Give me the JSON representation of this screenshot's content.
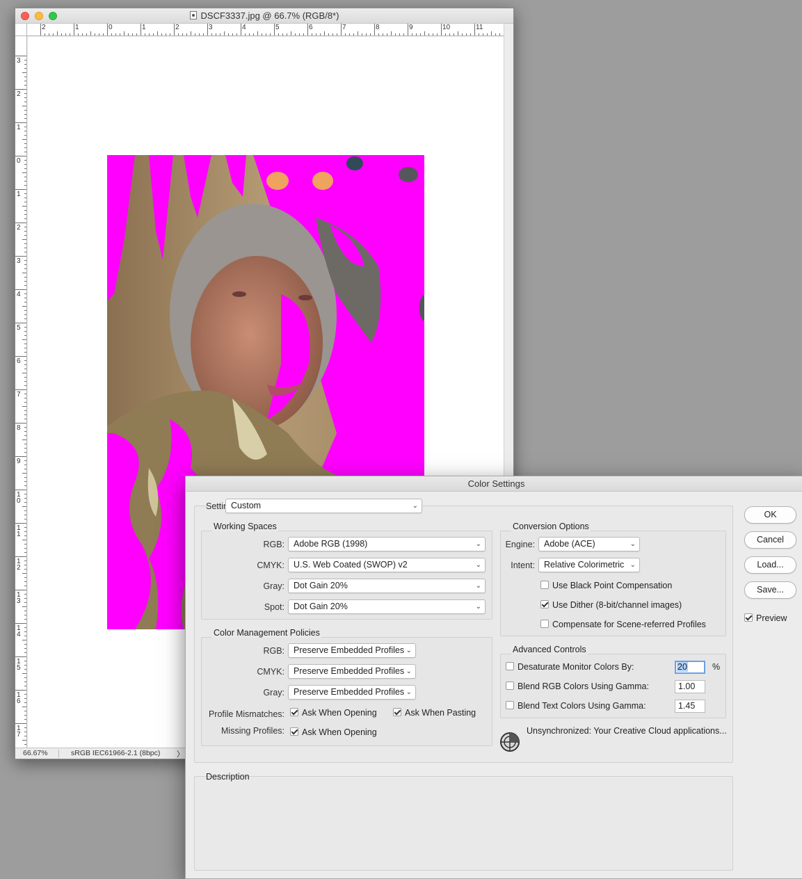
{
  "document": {
    "title": "DSCF3337.jpg @ 66.7% (RGB/8*)",
    "zoom": "66.67%",
    "color_profile": "sRGB IEC61966-2.1 (8bpc)",
    "status_arrow": "〉",
    "ruler_h_labels": [
      "2",
      "1",
      "0",
      "1",
      "2",
      "3",
      "4",
      "5",
      "6",
      "7",
      "8",
      "9",
      "10",
      "11"
    ],
    "ruler_v_labels": [
      "3",
      "2",
      "1",
      "0",
      "1",
      "2",
      "3",
      "4",
      "5",
      "6",
      "7",
      "8",
      "9",
      "10",
      "11",
      "12",
      "13",
      "14",
      "15",
      "16",
      "17"
    ],
    "overlay_color": "#ff00ff"
  },
  "dialog": {
    "title": "Color Settings",
    "settings_label": "Settings:",
    "settings_value": "Custom",
    "working_spaces": {
      "title": "Working Spaces",
      "rgb_label": "RGB:",
      "rgb_value": "Adobe RGB (1998)",
      "cmyk_label": "CMYK:",
      "cmyk_value": "U.S. Web Coated (SWOP) v2",
      "gray_label": "Gray:",
      "gray_value": "Dot Gain 20%",
      "spot_label": "Spot:",
      "spot_value": "Dot Gain 20%"
    },
    "policies": {
      "title": "Color Management Policies",
      "rgb_label": "RGB:",
      "rgb_value": "Preserve Embedded Profiles",
      "cmyk_label": "CMYK:",
      "cmyk_value": "Preserve Embedded Profiles",
      "gray_label": "Gray:",
      "gray_value": "Preserve Embedded Profiles",
      "mismatch_label": "Profile Mismatches:",
      "mismatch_opening": "Ask When Opening",
      "mismatch_pasting": "Ask When Pasting",
      "missing_label": "Missing Profiles:",
      "missing_opening": "Ask When Opening"
    },
    "conversion": {
      "title": "Conversion Options",
      "engine_label": "Engine:",
      "engine_value": "Adobe (ACE)",
      "intent_label": "Intent:",
      "intent_value": "Relative Colorimetric",
      "black_point": "Use Black Point Compensation",
      "dither": "Use Dither (8-bit/channel images)",
      "scene_referred": "Compensate for Scene-referred Profiles"
    },
    "advanced": {
      "title": "Advanced Controls",
      "desaturate": "Desaturate Monitor Colors By:",
      "desaturate_value": "20",
      "desaturate_unit": "%",
      "blend_rgb": "Blend RGB Colors Using Gamma:",
      "blend_rgb_value": "1.00",
      "blend_text": "Blend Text Colors Using Gamma:",
      "blend_text_value": "1.45"
    },
    "sync_status": "Unsynchronized: Your Creative Cloud applications...",
    "description_title": "Description",
    "buttons": {
      "ok": "OK",
      "cancel": "Cancel",
      "load": "Load...",
      "save": "Save..."
    },
    "preview_label": "Preview"
  }
}
